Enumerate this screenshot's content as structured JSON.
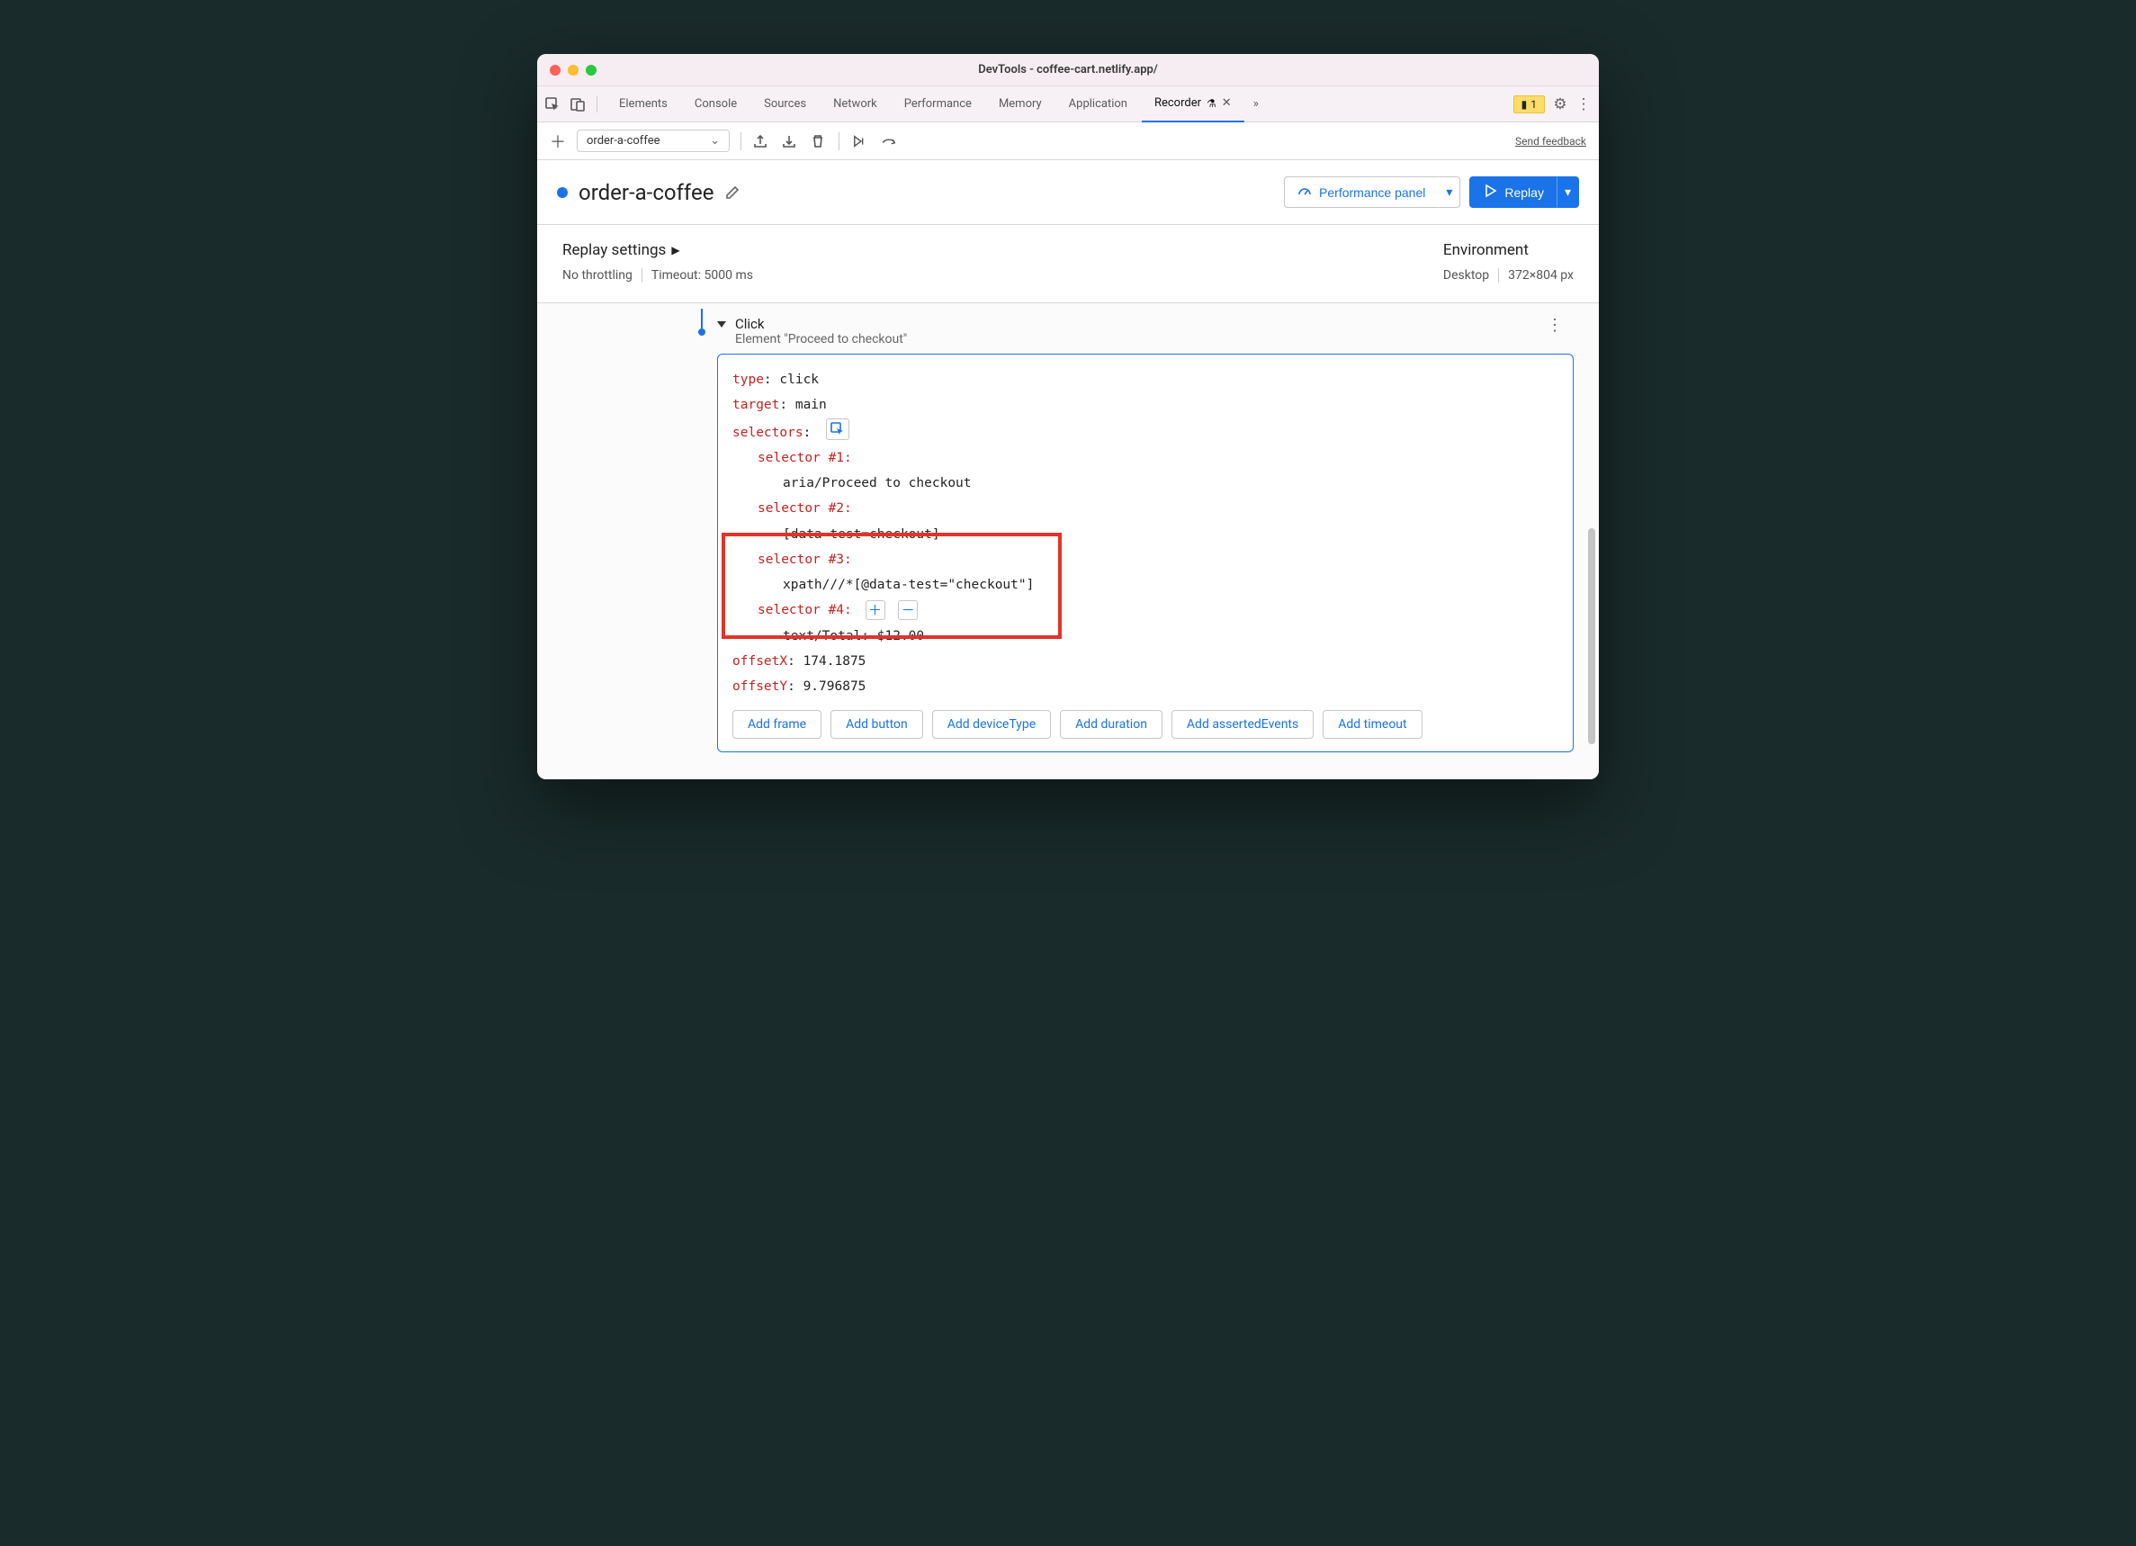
{
  "window_title": "DevTools - coffee-cart.netlify.app/",
  "tabs": {
    "elements": "Elements",
    "console": "Console",
    "sources": "Sources",
    "network": "Network",
    "performance": "Performance",
    "memory": "Memory",
    "application": "Application",
    "recorder": "Recorder"
  },
  "warning_count": "1",
  "recording_name": "order-a-coffee",
  "feedback": "Send feedback",
  "header": {
    "title": "order-a-coffee",
    "perf_panel": "Performance panel",
    "replay": "Replay"
  },
  "settings": {
    "replay_heading": "Replay settings",
    "throttling": "No throttling",
    "timeout": "Timeout: 5000 ms",
    "env_heading": "Environment",
    "device": "Desktop",
    "dims": "372×804 px"
  },
  "step": {
    "title": "Click",
    "subtitle": "Element \"Proceed to checkout\"",
    "type_k": "type",
    "type_v": ": click",
    "target_k": "target",
    "target_v": ": main",
    "selectors_k": "selectors",
    "selectors_v": ":",
    "s1": "selector #1:",
    "s1v": "aria/Proceed to checkout",
    "s2": "selector #2:",
    "s2v": "[data-test=checkout]",
    "s3": "selector #3:",
    "s3v": "xpath///*[@data-test=\"checkout\"]",
    "s4": "selector #4:",
    "s4v": "text/Total: $12.00",
    "ox_k": "offsetX",
    "ox_v": ": 174.1875",
    "oy_k": "offsetY",
    "oy_v": ": 9.796875"
  },
  "add_buttons": {
    "frame": "Add frame",
    "button": "Add button",
    "device": "Add deviceType",
    "duration": "Add duration",
    "asserted": "Add assertedEvents",
    "timeout": "Add timeout"
  }
}
